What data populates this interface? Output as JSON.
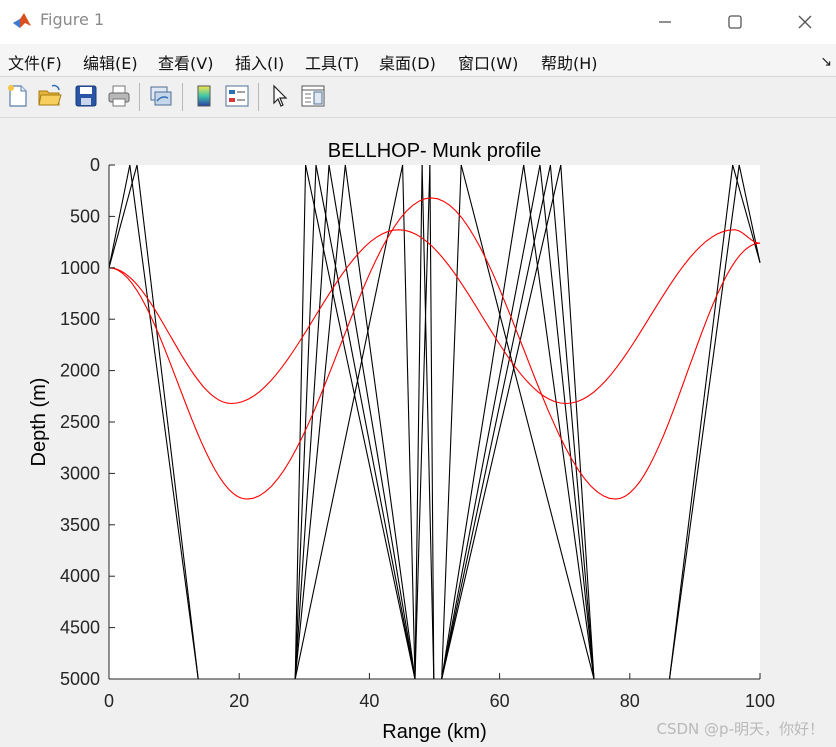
{
  "window": {
    "title": "Figure 1"
  },
  "menu": {
    "items": [
      "文件(F)",
      "编辑(E)",
      "查看(V)",
      "插入(I)",
      "工具(T)",
      "桌面(D)",
      "窗口(W)",
      "帮助(H)"
    ],
    "overflow_arrow": "↘"
  },
  "toolbar": {
    "icons": [
      "new-figure-icon",
      "open-file-icon",
      "save-icon",
      "print-icon",
      "link-plot-icon",
      "colorbar-icon",
      "legend-icon",
      "pointer-arrow-icon",
      "property-inspector-icon"
    ]
  },
  "chart_data": {
    "type": "line",
    "title": "BELLHOP- Munk profile",
    "xlabel": "Range (km)",
    "ylabel": "Depth (m)",
    "xlim": [
      0,
      100
    ],
    "ylim": [
      0,
      5000
    ],
    "y_reversed": true,
    "xticks": [
      0,
      20,
      40,
      60,
      80,
      100
    ],
    "yticks": [
      0,
      500,
      1000,
      1500,
      2000,
      2500,
      3000,
      3500,
      4000,
      4500,
      5000
    ],
    "grid": false,
    "source_depth": 1000,
    "red_rays": [
      {
        "turning_points": [
          [
            0,
            1000
          ],
          [
            21.2,
            3250
          ],
          [
            49.5,
            320
          ],
          [
            77.8,
            3250
          ],
          [
            100,
            760
          ]
        ],
        "color": "#ff0000"
      },
      {
        "turning_points": [
          [
            0,
            1000
          ],
          [
            18.8,
            2320
          ],
          [
            44.5,
            630
          ],
          [
            70.2,
            2320
          ],
          [
            96,
            630
          ],
          [
            100,
            760
          ]
        ],
        "color": "#ff0000"
      }
    ],
    "black_rays": {
      "color": "#000000",
      "reflect_top": [
        3.2,
        4.3,
        30.2,
        31.8,
        33.8,
        36.3,
        45.1,
        48.1,
        49.3,
        54.1,
        63.7,
        66.2,
        67.8,
        69.4,
        95.8,
        96.8
      ],
      "reflect_bottom": [
        13.7,
        14.8,
        18.7,
        19.5,
        21.3,
        22.5,
        24.2,
        26.8,
        28.6,
        47.0,
        49.9,
        51.1,
        74.5,
        76.3,
        77.5,
        80.4,
        81.4,
        85.0,
        86.1
      ]
    }
  },
  "watermark": "CSDN @p-明天，你好！",
  "colors": {
    "axes_background": "#ffffff",
    "figure_background": "#f0f0f0",
    "ray_black": "#000000",
    "ray_red": "#ff0000"
  }
}
